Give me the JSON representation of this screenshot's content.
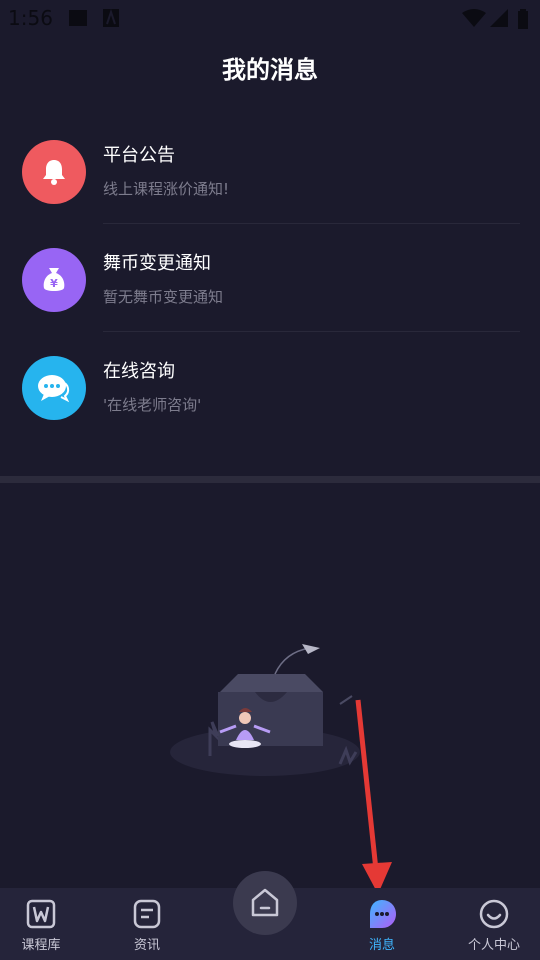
{
  "status_bar": {
    "time": "1:56"
  },
  "page": {
    "title": "我的消息"
  },
  "messages": [
    {
      "title": "平台公告",
      "subtitle": "线上课程涨价通知!",
      "icon": "bell-icon",
      "color": "#ef5a5f"
    },
    {
      "title": "舞币变更通知",
      "subtitle": "暂无舞币变更通知",
      "icon": "money-bag-icon",
      "color": "#9865f4"
    },
    {
      "title": "在线咨询",
      "subtitle": "'在线老师咨询'",
      "icon": "chat-bubble-icon",
      "color": "#26b4ee"
    }
  ],
  "tabs": [
    {
      "label": "课程库",
      "icon": "course-library-icon",
      "active": false
    },
    {
      "label": "资讯",
      "icon": "news-icon",
      "active": false
    },
    {
      "label": "",
      "icon": "home-icon",
      "active": false
    },
    {
      "label": "消息",
      "icon": "message-icon",
      "active": true
    },
    {
      "label": "个人中心",
      "icon": "smiley-profile-icon",
      "active": false
    }
  ],
  "colors": {
    "background": "#1b1a2c",
    "tab_bar": "#25243a",
    "accent": "#3fb6ff",
    "annotation_arrow": "#e53935"
  }
}
